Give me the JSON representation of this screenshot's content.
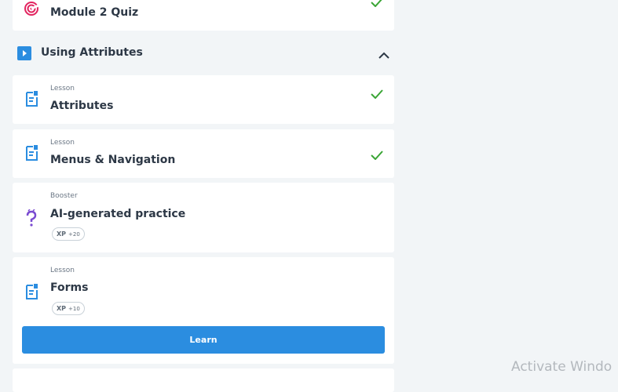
{
  "items": [
    {
      "kicker": "",
      "title": "Module 2 Quiz",
      "icon": "target-icon",
      "completed": true
    },
    {
      "kicker": "Lesson",
      "title": "Attributes",
      "icon": "lesson-doc-icon",
      "completed": true
    },
    {
      "kicker": "Lesson",
      "title": "Menus & Navigation",
      "icon": "lesson-doc-icon",
      "completed": true
    },
    {
      "kicker": "Booster",
      "title": "AI-generated practice",
      "icon": "question-icon",
      "completed": false,
      "xp_label": "XP",
      "xp_value": "+20"
    },
    {
      "kicker": "Lesson",
      "title": "Forms",
      "icon": "lesson-doc-icon",
      "completed": false,
      "xp_label": "XP",
      "xp_value": "+10",
      "action_label": "Learn"
    }
  ],
  "section": {
    "title": "Using Attributes",
    "icon": "play-icon",
    "expanded": true
  },
  "colors": {
    "accent": "#2b8de0",
    "check": "#3aa535",
    "quiz_icon": "#e2245f",
    "booster_icon": "#7a4bd1"
  },
  "watermark": "Activate Windo"
}
